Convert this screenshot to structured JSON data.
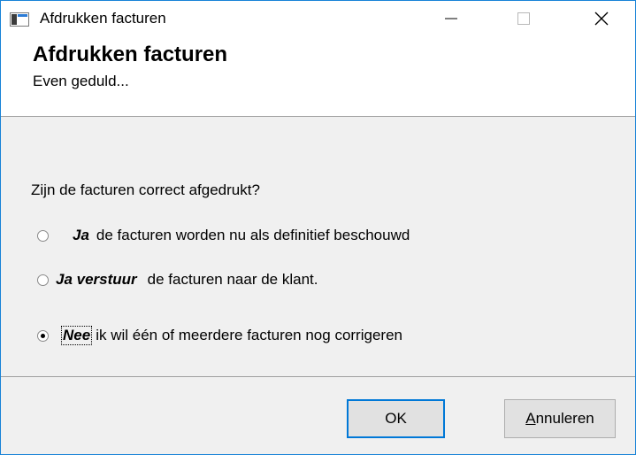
{
  "window": {
    "title": "Afdrukken facturen"
  },
  "titlebar": {
    "min_icon": "minimize-icon",
    "max_icon": "maximize-icon",
    "close_icon": "close-icon"
  },
  "header": {
    "title": "Afdrukken facturen",
    "subtitle": "Even geduld..."
  },
  "question": "Zijn de facturen correct afgedrukt?",
  "options": [
    {
      "key": "Ja",
      "text": "de facturen worden nu als definitief beschouwd",
      "checked": false
    },
    {
      "key": "Ja verstuur",
      "text": "de facturen naar de klant.",
      "checked": false
    },
    {
      "key": "Nee",
      "text": "ik wil één of meerdere facturen nog corrigeren",
      "checked": true
    }
  ],
  "buttons": {
    "ok": "OK",
    "cancel_first": "A",
    "cancel_rest": "nnuleren"
  },
  "colors": {
    "accent": "#0078d7",
    "window_border": "#1883d7"
  }
}
